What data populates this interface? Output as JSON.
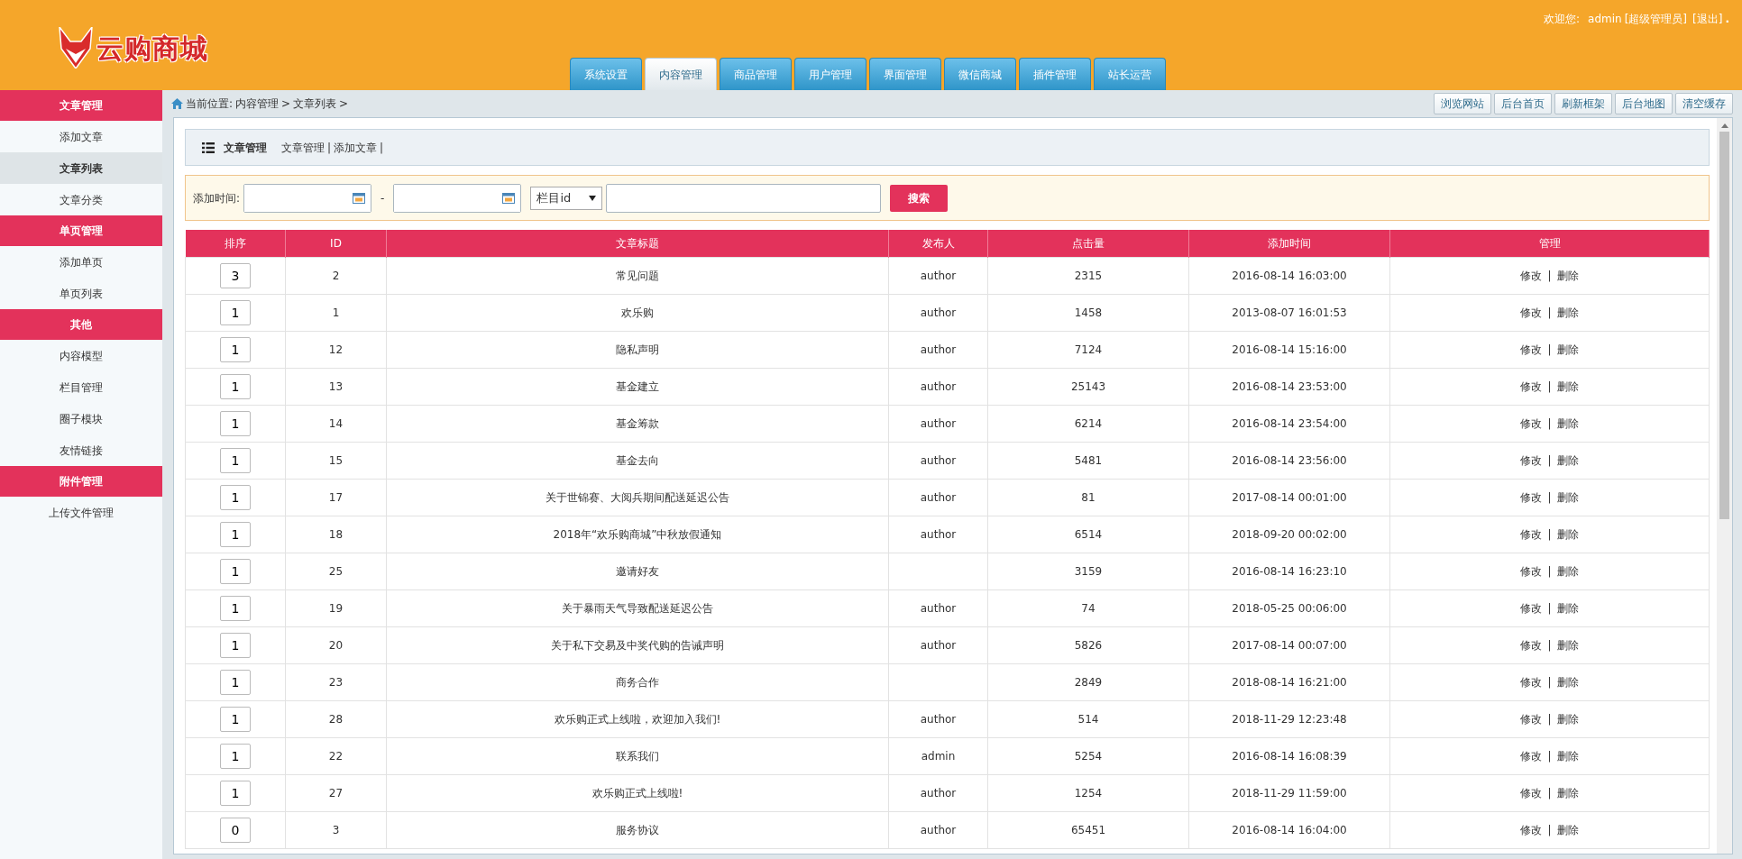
{
  "header": {
    "logo_text": "云购商城",
    "welcome_label": "欢迎您:",
    "user": "admin",
    "role": "[超级管理员]",
    "logout": "[退出]",
    "dot": "."
  },
  "tabs": [
    {
      "label": "系统设置",
      "selected": false
    },
    {
      "label": "内容管理",
      "selected": true
    },
    {
      "label": "商品管理",
      "selected": false
    },
    {
      "label": "用户管理",
      "selected": false
    },
    {
      "label": "界面管理",
      "selected": false
    },
    {
      "label": "微信商城",
      "selected": false
    },
    {
      "label": "插件管理",
      "selected": false
    },
    {
      "label": "站长运营",
      "selected": false
    }
  ],
  "sidebar": {
    "groups": [
      {
        "title": "文章管理",
        "items": [
          {
            "label": "添加文章",
            "selected": false
          },
          {
            "label": "文章列表",
            "selected": true
          },
          {
            "label": "文章分类",
            "selected": false
          }
        ]
      },
      {
        "title": "单页管理",
        "items": [
          {
            "label": "添加单页",
            "selected": false
          },
          {
            "label": "单页列表",
            "selected": false
          }
        ]
      },
      {
        "title": "其他",
        "items": [
          {
            "label": "内容模型",
            "selected": false
          },
          {
            "label": "栏目管理",
            "selected": false
          },
          {
            "label": "圈子模块",
            "selected": false
          },
          {
            "label": "友情链接",
            "selected": false
          }
        ]
      },
      {
        "title": "附件管理",
        "items": [
          {
            "label": "上传文件管理",
            "selected": false
          }
        ]
      }
    ]
  },
  "breadcrumb": {
    "label": "当前位置:",
    "items": [
      "内容管理",
      ">",
      "文章列表",
      ">"
    ]
  },
  "toolbar_buttons": [
    "浏览网站",
    "后台首页",
    "刷新框架",
    "后台地图",
    "清空缓存"
  ],
  "panel": {
    "title": "文章管理",
    "links": [
      {
        "label": "文章管理",
        "sep": "|"
      },
      {
        "label": "添加文章",
        "sep": "|"
      }
    ]
  },
  "search": {
    "label": "添加时间:",
    "dash": "-",
    "select_value": "栏目id",
    "button": "搜索"
  },
  "table": {
    "columns": [
      "排序",
      "ID",
      "文章标题",
      "发布人",
      "点击量",
      "添加时间",
      "管理"
    ],
    "rows": [
      {
        "order": "3",
        "id": "2",
        "title": "常见问题",
        "author": "author",
        "hits": "2315",
        "time": "2016-08-14 16:03:00",
        "edit": "修改",
        "sep": "|",
        "delete": "删除"
      },
      {
        "order": "1",
        "id": "1",
        "title": "欢乐购",
        "author": "author",
        "hits": "1458",
        "time": "2013-08-07 16:01:53",
        "edit": "修改",
        "sep": "|",
        "delete": "删除"
      },
      {
        "order": "1",
        "id": "12",
        "title": "隐私声明",
        "author": "author",
        "hits": "7124",
        "time": "2016-08-14 15:16:00",
        "edit": "修改",
        "sep": "|",
        "delete": "删除"
      },
      {
        "order": "1",
        "id": "13",
        "title": "基金建立",
        "author": "author",
        "hits": "25143",
        "time": "2016-08-14 23:53:00",
        "edit": "修改",
        "sep": "|",
        "delete": "删除"
      },
      {
        "order": "1",
        "id": "14",
        "title": "基金筹款",
        "author": "author",
        "hits": "6214",
        "time": "2016-08-14 23:54:00",
        "edit": "修改",
        "sep": "|",
        "delete": "删除"
      },
      {
        "order": "1",
        "id": "15",
        "title": "基金去向",
        "author": "author",
        "hits": "5481",
        "time": "2016-08-14 23:56:00",
        "edit": "修改",
        "sep": "|",
        "delete": "删除"
      },
      {
        "order": "1",
        "id": "17",
        "title": "关于世锦赛、大阅兵期间配送延迟公告",
        "author": "author",
        "hits": "81",
        "time": "2017-08-14 00:01:00",
        "edit": "修改",
        "sep": "|",
        "delete": "删除"
      },
      {
        "order": "1",
        "id": "18",
        "title": "2018年“欢乐购商城”中秋放假通知",
        "author": "author",
        "hits": "6514",
        "time": "2018-09-20 00:02:00",
        "edit": "修改",
        "sep": "|",
        "delete": "删除"
      },
      {
        "order": "1",
        "id": "25",
        "title": "邀请好友",
        "hits": "3159",
        "time": "2016-08-14 16:23:10",
        "edit": "修改",
        "sep": "|",
        "delete": "删除"
      },
      {
        "order": "1",
        "id": "19",
        "title": "关于暴雨天气导致配送延迟公告",
        "author": "author",
        "hits": "74",
        "time": "2018-05-25 00:06:00",
        "edit": "修改",
        "sep": "|",
        "delete": "删除"
      },
      {
        "order": "1",
        "id": "20",
        "title": "关于私下交易及中奖代购的告诫声明",
        "author": "author",
        "hits": "5826",
        "time": "2017-08-14 00:07:00",
        "edit": "修改",
        "sep": "|",
        "delete": "删除"
      },
      {
        "order": "1",
        "id": "23",
        "title": "商务合作",
        "hits": "2849",
        "time": "2018-08-14 16:21:00",
        "edit": "修改",
        "sep": "|",
        "delete": "删除"
      },
      {
        "order": "1",
        "id": "28",
        "title": "欢乐购正式上线啦，欢迎加入我们!",
        "author": "author",
        "hits": "514",
        "time": "2018-11-29 12:23:48",
        "edit": "修改",
        "sep": "|",
        "delete": "删除"
      },
      {
        "order": "1",
        "id": "22",
        "title": "联系我们",
        "author": "admin",
        "hits": "5254",
        "time": "2016-08-14 16:08:39",
        "edit": "修改",
        "sep": "|",
        "delete": "删除"
      },
      {
        "order": "1",
        "id": "27",
        "title": "欢乐购正式上线啦!",
        "author": "author",
        "hits": "1254",
        "time": "2018-11-29 11:59:00",
        "edit": "修改",
        "sep": "|",
        "delete": "删除"
      },
      {
        "order": "0",
        "id": "3",
        "title": "服务协议",
        "author": "author",
        "hits": "65451",
        "time": "2016-08-14 16:04:00",
        "edit": "修改",
        "sep": "|",
        "delete": "删除"
      }
    ]
  }
}
